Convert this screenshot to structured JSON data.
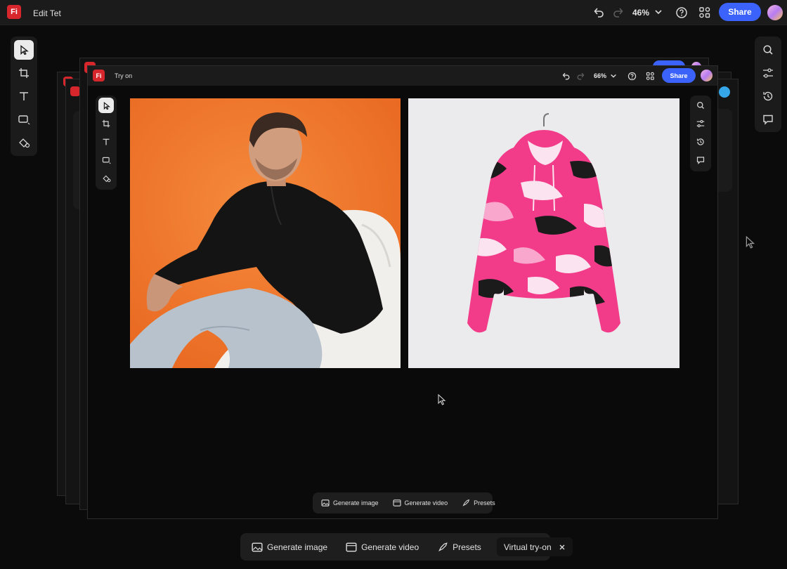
{
  "app": {
    "logo": "Fi",
    "title": "Edit Tet",
    "zoom": "46%",
    "share_label": "Share"
  },
  "inner": {
    "logo": "Fi",
    "title": "Try on",
    "zoom": "66%",
    "share_label": "Share"
  },
  "images": {
    "person": {
      "background_color": "#f0762a",
      "hoodie_color": "#111111",
      "pants_color": "#b7c2cc",
      "beanbag_color": "#f1efec"
    },
    "garment": {
      "background_color": "#ebebee",
      "camo_colors": [
        "#f23c8a",
        "#f9a7cd",
        "#1b1b1b",
        "#fbe4ef"
      ]
    }
  },
  "inner_generate_bar": {
    "generate_image": "Generate image",
    "generate_video": "Generate video",
    "presets": "Presets"
  },
  "generate_bar": {
    "generate_image": "Generate image",
    "generate_video": "Generate video",
    "presets": "Presets",
    "virtual_tryon": "Virtual try-on"
  },
  "icons": {
    "select": "pointer-icon",
    "crop": "crop-icon",
    "text": "text-icon",
    "shape": "rectangle-icon",
    "fill": "paint-bucket-icon",
    "search": "search-icon",
    "adjust": "sliders-icon",
    "history": "history-icon",
    "comment": "comment-icon"
  },
  "colors": {
    "accent": "#3b63fb",
    "logo": "#d7262c",
    "panel": "#1b1b1b"
  }
}
